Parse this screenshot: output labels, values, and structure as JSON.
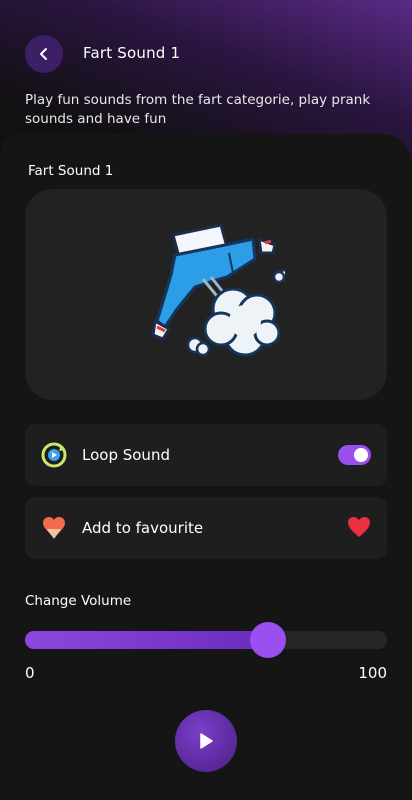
{
  "header": {
    "title": "Fart Sound 1",
    "description": "Play fun sounds from the fart categorie, play prank sounds and have fun"
  },
  "card": {
    "title": "Fart Sound 1",
    "image_icon": "cartoon-fart-illustration"
  },
  "options": {
    "loop": {
      "label": "Loop Sound",
      "enabled": true,
      "icon": "loop-icon"
    },
    "favourite": {
      "label": "Add to favourite",
      "favourited": true,
      "icon": "favourite-icon"
    }
  },
  "volume": {
    "label": "Change Volume",
    "min_label": "0",
    "max_label": "100",
    "value": 67
  },
  "colors": {
    "accent": "#9b4fee",
    "heart": "#e8303f"
  },
  "icons": {
    "back": "chevron-left-icon",
    "play": "play-icon"
  }
}
